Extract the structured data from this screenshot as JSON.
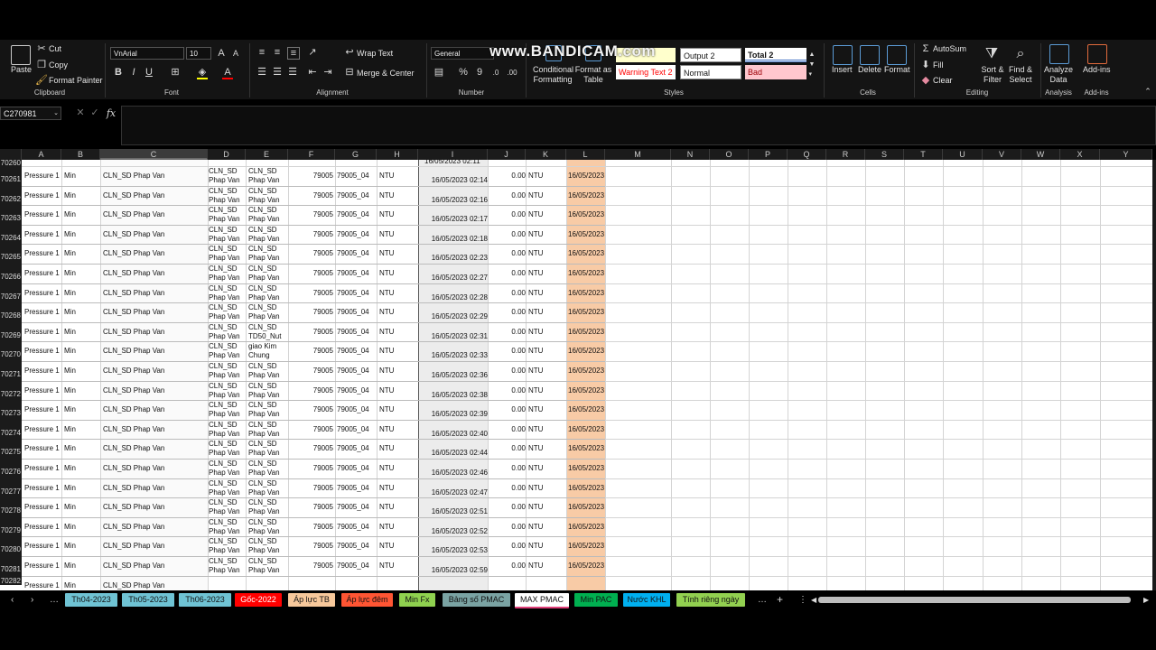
{
  "ribbon": {
    "clipboard": {
      "paste": "Paste",
      "cut": "Cut",
      "copy": "Copy",
      "format_painter": "Format Painter",
      "group": "Clipboard"
    },
    "font": {
      "name": "VnArial",
      "size": "10",
      "group": "Font"
    },
    "alignment": {
      "wrap_text": "Wrap Text",
      "merge_center": "Merge & Center",
      "group": "Alignment"
    },
    "number": {
      "format": "General",
      "group": "Number"
    },
    "styles": {
      "conditional": [
        "Conditional",
        "Formatting"
      ],
      "format_table": [
        "Format as",
        "Table"
      ],
      "output2": "Output 2",
      "total2": "Total 2",
      "warning": "Warning Text 2",
      "normal": "Normal",
      "bad": "Bad",
      "group": "Styles"
    },
    "cells": {
      "insert": "Insert",
      "delete": "Delete",
      "format": "Format",
      "group": "Cells"
    },
    "editing": {
      "autosum": "AutoSum",
      "fill": "Fill",
      "clear": "Clear",
      "sort": [
        "Sort &",
        "Filter"
      ],
      "find": [
        "Find &",
        "Select"
      ],
      "group": "Editing"
    },
    "analysis": {
      "analyze": [
        "Analyze",
        "Data"
      ],
      "group": "Analysis"
    },
    "addins": {
      "label": "Add-ins",
      "group": "Add-ins"
    }
  },
  "watermark": "www.BANDICAM.com",
  "formula_bar": {
    "name_box": "C270981",
    "fx": "fx",
    "value": ""
  },
  "columns": [
    "A",
    "B",
    "C",
    "D",
    "E",
    "F",
    "G",
    "H",
    "I",
    "J",
    "K",
    "L",
    "M",
    "N",
    "O",
    "P",
    "Q",
    "R",
    "S",
    "T",
    "U",
    "V",
    "W",
    "X",
    "Y"
  ],
  "rows": [
    {
      "n": "70261",
      "a": "Pressure 1",
      "b": "Min",
      "c": "CLN_SD Phap Van",
      "d": [
        "CLN_SD",
        "Phap Van"
      ],
      "e": [
        "CLN_SD",
        "Phap Van"
      ],
      "f": "79005",
      "g": "79005_04",
      "h": "NTU",
      "i": "16/05/2023 02:14",
      "j": "0.00",
      "k": "NTU",
      "l": "16/05/2023"
    },
    {
      "n": "70262",
      "a": "Pressure 1",
      "b": "Min",
      "c": "CLN_SD Phap Van",
      "d": [
        "CLN_SD",
        "Phap Van"
      ],
      "e": [
        "CLN_SD",
        "Phap Van"
      ],
      "f": "79005",
      "g": "79005_04",
      "h": "NTU",
      "i": "16/05/2023 02:16",
      "j": "0.00",
      "k": "NTU",
      "l": "16/05/2023"
    },
    {
      "n": "70263",
      "a": "Pressure 1",
      "b": "Min",
      "c": "CLN_SD Phap Van",
      "d": [
        "CLN_SD",
        "Phap Van"
      ],
      "e": [
        "CLN_SD",
        "Phap Van"
      ],
      "f": "79005",
      "g": "79005_04",
      "h": "NTU",
      "i": "16/05/2023 02:17",
      "j": "0.00",
      "k": "NTU",
      "l": "16/05/2023"
    },
    {
      "n": "70264",
      "a": "Pressure 1",
      "b": "Min",
      "c": "CLN_SD Phap Van",
      "d": [
        "CLN_SD",
        "Phap Van"
      ],
      "e": [
        "CLN_SD",
        "Phap Van"
      ],
      "f": "79005",
      "g": "79005_04",
      "h": "NTU",
      "i": "16/05/2023 02:18",
      "j": "0.00",
      "k": "NTU",
      "l": "16/05/2023"
    },
    {
      "n": "70265",
      "a": "Pressure 1",
      "b": "Min",
      "c": "CLN_SD Phap Van",
      "d": [
        "CLN_SD",
        "Phap Van"
      ],
      "e": [
        "CLN_SD",
        "Phap Van"
      ],
      "f": "79005",
      "g": "79005_04",
      "h": "NTU",
      "i": "16/05/2023 02:23",
      "j": "0.00",
      "k": "NTU",
      "l": "16/05/2023"
    },
    {
      "n": "70266",
      "a": "Pressure 1",
      "b": "Min",
      "c": "CLN_SD Phap Van",
      "d": [
        "CLN_SD",
        "Phap Van"
      ],
      "e": [
        "CLN_SD",
        "Phap Van"
      ],
      "f": "79005",
      "g": "79005_04",
      "h": "NTU",
      "i": "16/05/2023 02:27",
      "j": "0.00",
      "k": "NTU",
      "l": "16/05/2023"
    },
    {
      "n": "70267",
      "a": "Pressure 1",
      "b": "Min",
      "c": "CLN_SD Phap Van",
      "d": [
        "CLN_SD",
        "Phap Van"
      ],
      "e": [
        "CLN_SD",
        "Phap Van"
      ],
      "f": "79005",
      "g": "79005_04",
      "h": "NTU",
      "i": "16/05/2023 02:28",
      "j": "0.00",
      "k": "NTU",
      "l": "16/05/2023"
    },
    {
      "n": "70268",
      "a": "Pressure 1",
      "b": "Min",
      "c": "CLN_SD Phap Van",
      "d": [
        "CLN_SD",
        "Phap Van"
      ],
      "e": [
        "CLN_SD",
        "Phap Van"
      ],
      "f": "79005",
      "g": "79005_04",
      "h": "NTU",
      "i": "16/05/2023 02:29",
      "j": "0.00",
      "k": "NTU",
      "l": "16/05/2023"
    },
    {
      "n": "70269",
      "a": "Pressure 1",
      "b": "Min",
      "c": "CLN_SD Phap Van",
      "d": [
        "CLN_SD",
        "Phap Van"
      ],
      "e": [
        "CLN_SD",
        "TD50_Nut"
      ],
      "f": "79005",
      "g": "79005_04",
      "h": "NTU",
      "i": "16/05/2023 02:31",
      "j": "0.00",
      "k": "NTU",
      "l": "16/05/2023"
    },
    {
      "n": "70270",
      "a": "Pressure 1",
      "b": "Min",
      "c": "CLN_SD Phap Van",
      "d": [
        "CLN_SD",
        "Phap Van"
      ],
      "e": [
        "giao Kim",
        "Chung"
      ],
      "f": "79005",
      "g": "79005_04",
      "h": "NTU",
      "i": "16/05/2023 02:33",
      "j": "0.00",
      "k": "NTU",
      "l": "16/05/2023"
    },
    {
      "n": "70271",
      "a": "Pressure 1",
      "b": "Min",
      "c": "CLN_SD Phap Van",
      "d": [
        "CLN_SD",
        "Phap Van"
      ],
      "e": [
        "CLN_SD",
        "Phap Van"
      ],
      "f": "79005",
      "g": "79005_04",
      "h": "NTU",
      "i": "16/05/2023 02:36",
      "j": "0.00",
      "k": "NTU",
      "l": "16/05/2023"
    },
    {
      "n": "70272",
      "a": "Pressure 1",
      "b": "Min",
      "c": "CLN_SD Phap Van",
      "d": [
        "CLN_SD",
        "Phap Van"
      ],
      "e": [
        "CLN_SD",
        "Phap Van"
      ],
      "f": "79005",
      "g": "79005_04",
      "h": "NTU",
      "i": "16/05/2023 02:38",
      "j": "0.00",
      "k": "NTU",
      "l": "16/05/2023"
    },
    {
      "n": "70273",
      "a": "Pressure 1",
      "b": "Min",
      "c": "CLN_SD Phap Van",
      "d": [
        "CLN_SD",
        "Phap Van"
      ],
      "e": [
        "CLN_SD",
        "Phap Van"
      ],
      "f": "79005",
      "g": "79005_04",
      "h": "NTU",
      "i": "16/05/2023 02:39",
      "j": "0.00",
      "k": "NTU",
      "l": "16/05/2023"
    },
    {
      "n": "70274",
      "a": "Pressure 1",
      "b": "Min",
      "c": "CLN_SD Phap Van",
      "d": [
        "CLN_SD",
        "Phap Van"
      ],
      "e": [
        "CLN_SD",
        "Phap Van"
      ],
      "f": "79005",
      "g": "79005_04",
      "h": "NTU",
      "i": "16/05/2023 02:40",
      "j": "0.00",
      "k": "NTU",
      "l": "16/05/2023"
    },
    {
      "n": "70275",
      "a": "Pressure 1",
      "b": "Min",
      "c": "CLN_SD Phap Van",
      "d": [
        "CLN_SD",
        "Phap Van"
      ],
      "e": [
        "CLN_SD",
        "Phap Van"
      ],
      "f": "79005",
      "g": "79005_04",
      "h": "NTU",
      "i": "16/05/2023 02:44",
      "j": "0.00",
      "k": "NTU",
      "l": "16/05/2023"
    },
    {
      "n": "70276",
      "a": "Pressure 1",
      "b": "Min",
      "c": "CLN_SD Phap Van",
      "d": [
        "CLN_SD",
        "Phap Van"
      ],
      "e": [
        "CLN_SD",
        "Phap Van"
      ],
      "f": "79005",
      "g": "79005_04",
      "h": "NTU",
      "i": "16/05/2023 02:46",
      "j": "0.00",
      "k": "NTU",
      "l": "16/05/2023"
    },
    {
      "n": "70277",
      "a": "Pressure 1",
      "b": "Min",
      "c": "CLN_SD Phap Van",
      "d": [
        "CLN_SD",
        "Phap Van"
      ],
      "e": [
        "CLN_SD",
        "Phap Van"
      ],
      "f": "79005",
      "g": "79005_04",
      "h": "NTU",
      "i": "16/05/2023 02:47",
      "j": "0.00",
      "k": "NTU",
      "l": "16/05/2023"
    },
    {
      "n": "70278",
      "a": "Pressure 1",
      "b": "Min",
      "c": "CLN_SD Phap Van",
      "d": [
        "CLN_SD",
        "Phap Van"
      ],
      "e": [
        "CLN_SD",
        "Phap Van"
      ],
      "f": "79005",
      "g": "79005_04",
      "h": "NTU",
      "i": "16/05/2023 02:51",
      "j": "0.00",
      "k": "NTU",
      "l": "16/05/2023"
    },
    {
      "n": "70279",
      "a": "Pressure 1",
      "b": "Min",
      "c": "CLN_SD Phap Van",
      "d": [
        "CLN_SD",
        "Phap Van"
      ],
      "e": [
        "CLN_SD",
        "Phap Van"
      ],
      "f": "79005",
      "g": "79005_04",
      "h": "NTU",
      "i": "16/05/2023 02:52",
      "j": "0.00",
      "k": "NTU",
      "l": "16/05/2023"
    },
    {
      "n": "70280",
      "a": "Pressure 1",
      "b": "Min",
      "c": "CLN_SD Phap Van",
      "d": [
        "CLN_SD",
        "Phap Van"
      ],
      "e": [
        "CLN_SD",
        "Phap Van"
      ],
      "f": "79005",
      "g": "79005_04",
      "h": "NTU",
      "i": "16/05/2023 02:53",
      "j": "0.00",
      "k": "NTU",
      "l": "16/05/2023"
    },
    {
      "n": "70281",
      "a": "Pressure 1",
      "b": "Min",
      "c": "CLN_SD Phap Van",
      "d": [
        "CLN_SD",
        "Phap Van"
      ],
      "e": [
        "CLN_SD",
        "Phap Van"
      ],
      "f": "79005",
      "g": "79005_04",
      "h": "NTU",
      "i": "16/05/2023 02:59",
      "j": "0.00",
      "k": "NTU",
      "l": "16/05/2023"
    }
  ],
  "partial_rows": {
    "top_n": "70260",
    "top_i": "16/05/2023 02:11",
    "bottom_n": "70282",
    "bottom_a": "Pressure 1",
    "bottom_b": "Min",
    "bottom_c": "CLN_SD Phap Van"
  },
  "sheet_tabs": [
    {
      "label": "Th04-2023",
      "color": "#6fc3d4"
    },
    {
      "label": "Th05-2023",
      "color": "#6fc3d4"
    },
    {
      "label": "Th06-2023",
      "color": "#6fc3d4"
    },
    {
      "label": "Gốc-2022",
      "color": "#ff0000",
      "text": "#ffffff"
    },
    {
      "label": "Áp lực TB",
      "color": "#f7c89b"
    },
    {
      "label": "Áp lực đêm",
      "color": "#ff5533"
    },
    {
      "label": "Min Fx",
      "color": "#8fd14f"
    },
    {
      "label": "Bảng số PMAC",
      "color": "#7aa3a3"
    },
    {
      "label": "MAX PMAC",
      "color": "#ffffff",
      "active": true
    },
    {
      "label": "Min PAC",
      "color": "#00b050"
    },
    {
      "label": "Nước KHL",
      "color": "#00b0f0"
    },
    {
      "label": "Tính riêng ngày",
      "color": "#92d050"
    }
  ],
  "colors": {
    "highlight_I": "#ececec",
    "highlight_L": "#f8cba6",
    "active_col": "#3b3b3b"
  }
}
